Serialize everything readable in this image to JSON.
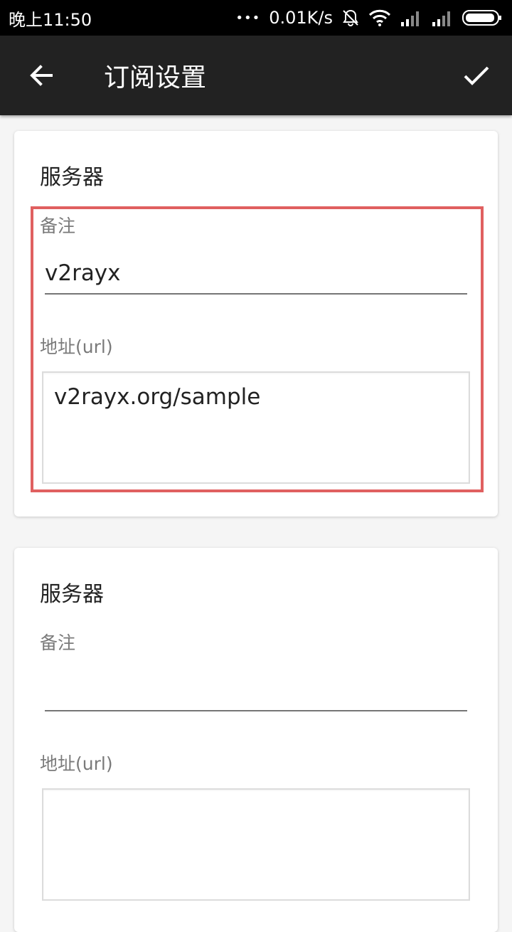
{
  "statusbar": {
    "time": "晚上11:50",
    "dots": "•••",
    "speed": "0.01K/s"
  },
  "appbar": {
    "title": "订阅设置",
    "back_icon": "arrow-left-icon",
    "confirm_icon": "check-icon"
  },
  "cards": [
    {
      "title": "服务器",
      "remark_label": "备注",
      "remark_value": "v2rayx",
      "url_label": "地址(url)",
      "url_value": "v2rayx.org/sample",
      "highlighted": true
    },
    {
      "title": "服务器",
      "remark_label": "备注",
      "remark_value": "",
      "url_label": "地址(url)",
      "url_value": "",
      "highlighted": false
    }
  ],
  "colors": {
    "appbar": "#222222",
    "statusbar": "#000000",
    "highlight": "#e06060",
    "background": "#f5f5f5"
  }
}
